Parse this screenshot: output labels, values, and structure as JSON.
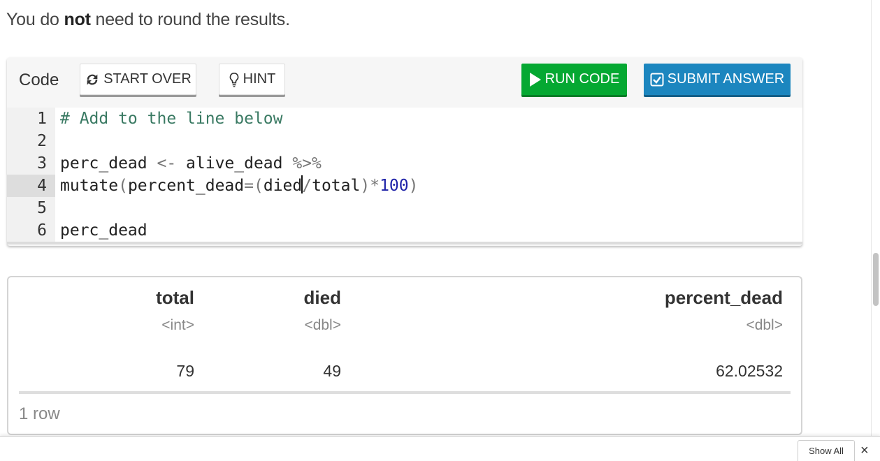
{
  "instructions": {
    "pre": "You do ",
    "bold": "not",
    "post": " need to round the results."
  },
  "code_panel": {
    "label": "Code",
    "start_over": "START OVER",
    "hint": "HINT",
    "run": "RUN CODE",
    "submit": "SUBMIT ANSWER",
    "colors": {
      "run": "#05a832",
      "submit": "#1c86bf"
    },
    "icons": {
      "start_over": "refresh-icon",
      "hint": "lightbulb-icon",
      "run": "play-icon",
      "submit": "checkbox-icon"
    },
    "editor": {
      "active_line": 4,
      "line_numbers": [
        "1",
        "2",
        "3",
        "4",
        "5",
        "6"
      ],
      "lines": {
        "l1": "# Add to the line below",
        "l3_var": "perc_dead ",
        "l3_assign": "<-",
        "l3_src": " alive_dead ",
        "l3_pipe": "%>%",
        "l4_fn": "mutate",
        "l4_open": "(",
        "l4_arg": "percent_dead",
        "l4_eq": "=",
        "l4_open2": "(",
        "l4_a": "died",
        "l4_div": "/",
        "l4_b": "total",
        "l4_close": ")",
        "l4_mul": "*",
        "l4_num": "100",
        "l4_close2": ")",
        "l6": "perc_dead"
      }
    }
  },
  "output": {
    "columns": [
      {
        "name": "total",
        "type": "<int>"
      },
      {
        "name": "died",
        "type": "<dbl>"
      },
      {
        "name": "percent_dead",
        "type": "<dbl>"
      }
    ],
    "rows": [
      [
        "79",
        "49",
        "62.02532"
      ]
    ],
    "row_count": "1 row"
  },
  "bottom_bar": {
    "show_all": "Show All",
    "close": "×"
  }
}
